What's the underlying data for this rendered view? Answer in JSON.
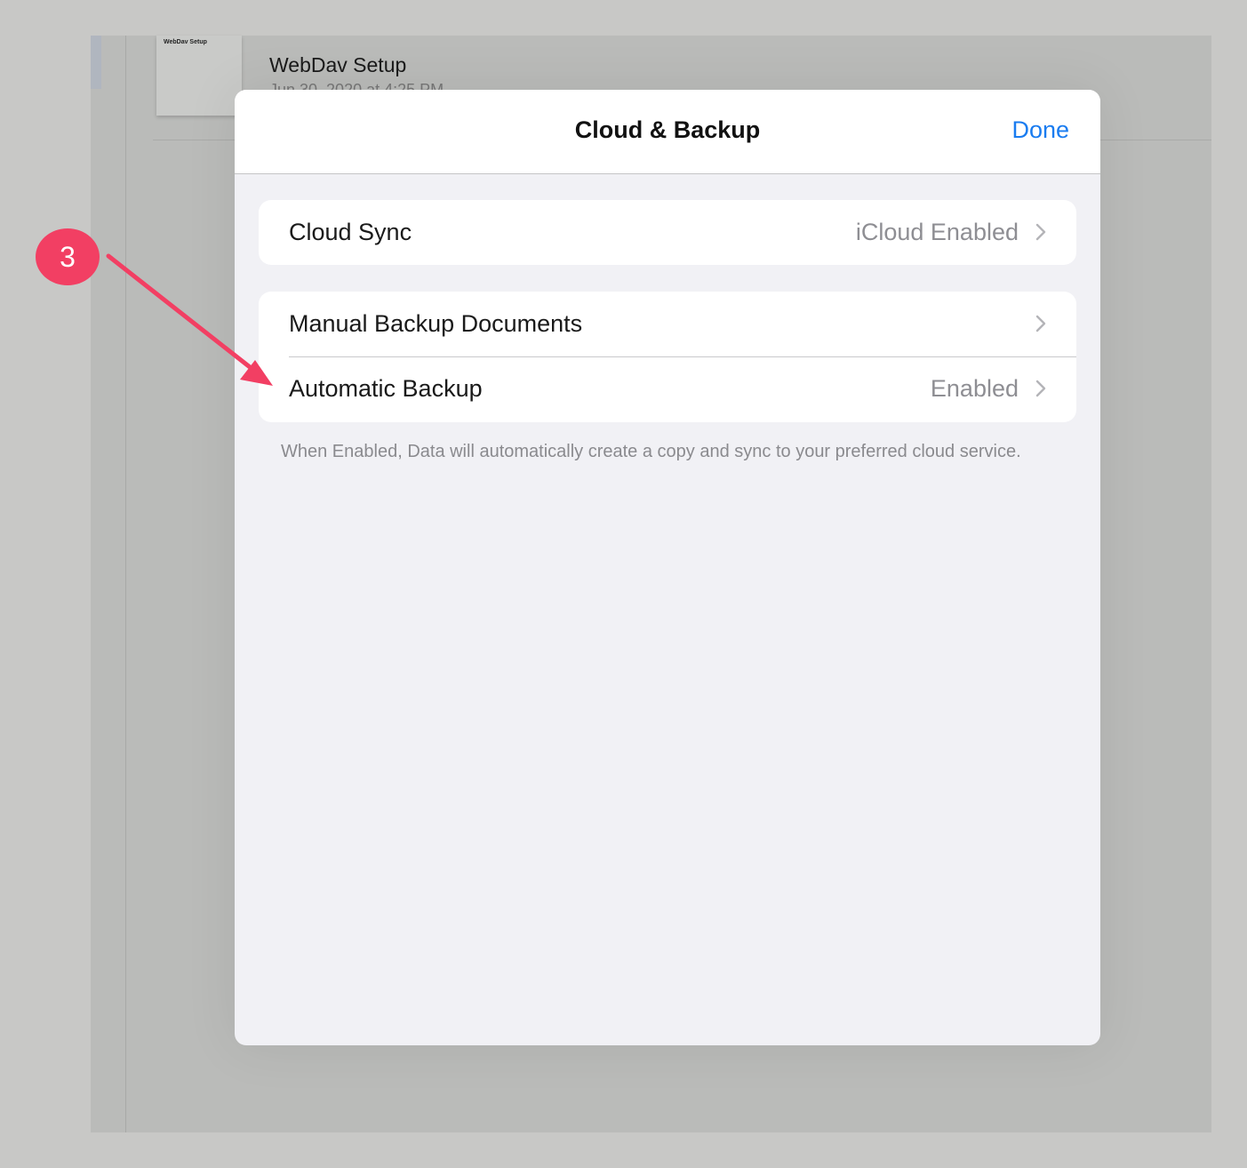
{
  "background": {
    "doc_thumb_label": "WebDav Setup",
    "doc_title": "WebDav Setup",
    "doc_date": "Jun 30, 2020 at 4:25 PM"
  },
  "modal": {
    "title": "Cloud & Backup",
    "done_label": "Done",
    "groups": [
      {
        "rows": [
          {
            "label": "Cloud Sync",
            "value": "iCloud Enabled"
          }
        ]
      },
      {
        "rows": [
          {
            "label": "Manual Backup Documents",
            "value": ""
          },
          {
            "label": "Automatic Backup",
            "value": "Enabled"
          }
        ]
      }
    ],
    "footer_note": "When Enabled, Data will automatically create a copy and sync to your preferred cloud service."
  },
  "annotation": {
    "step_number": "3",
    "color": "#f23f63"
  },
  "colors": {
    "accent": "#1a7cf0",
    "secondary_text": "#8e8e93"
  }
}
